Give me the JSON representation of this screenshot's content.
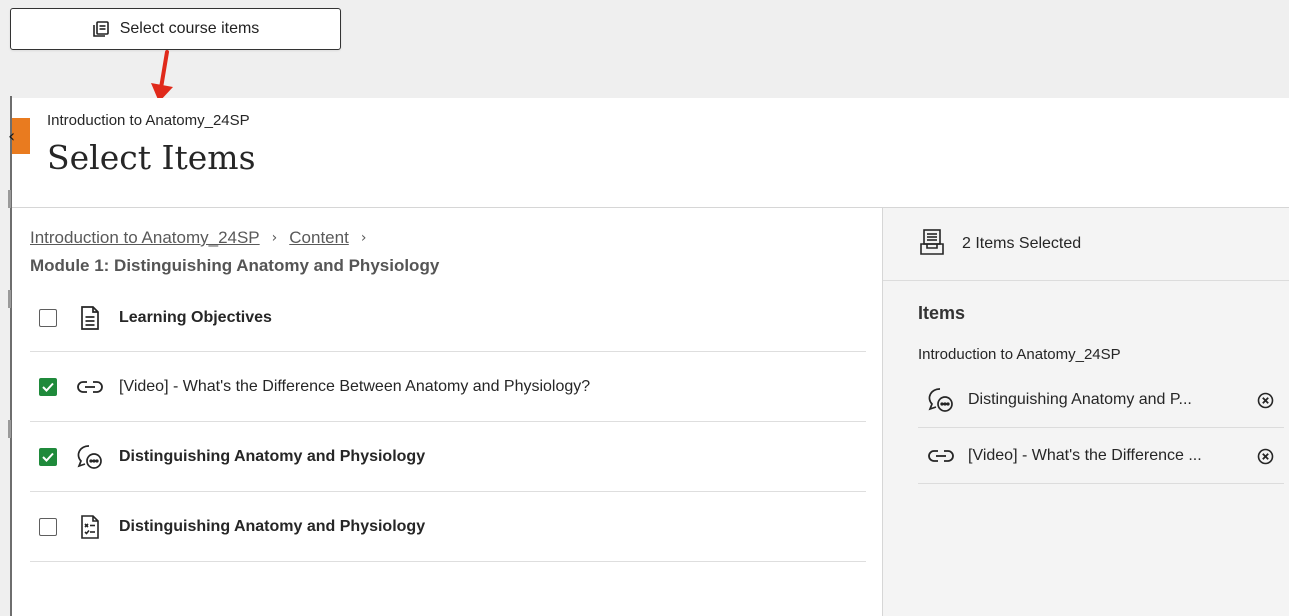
{
  "callout": {
    "button_label": "Select course items"
  },
  "header": {
    "course_name": "Introduction to Anatomy_24SP",
    "title": "Select Items",
    "collapse_glyph": "‹"
  },
  "breadcrumb": {
    "course_link": "Introduction to Anatomy_24SP",
    "content_link": "Content",
    "separator": "›",
    "current": "Module 1: Distinguishing Anatomy and Physiology"
  },
  "items": [
    {
      "label": "Learning Objectives",
      "checked": false,
      "icon": "document-icon"
    },
    {
      "label": "[Video] - What's the Difference Between Anatomy and Physiology?",
      "checked": true,
      "icon": "link-icon"
    },
    {
      "label": "Distinguishing Anatomy and Physiology",
      "checked": true,
      "icon": "discussion-icon"
    },
    {
      "label": "Distinguishing Anatomy and Physiology",
      "checked": false,
      "icon": "quiz-icon"
    }
  ],
  "selection": {
    "count_label": "2 Items Selected",
    "items_heading": "Items",
    "group_title": "Introduction to Anatomy_24SP",
    "selected": [
      {
        "label": "Distinguishing Anatomy and P...",
        "icon": "discussion-icon"
      },
      {
        "label": "[Video] - What's the Difference ...",
        "icon": "link-icon"
      }
    ]
  },
  "colors": {
    "accent_orange": "#e97b1f",
    "check_green": "#1f8a3b",
    "arrow_red": "#e02a1b"
  }
}
